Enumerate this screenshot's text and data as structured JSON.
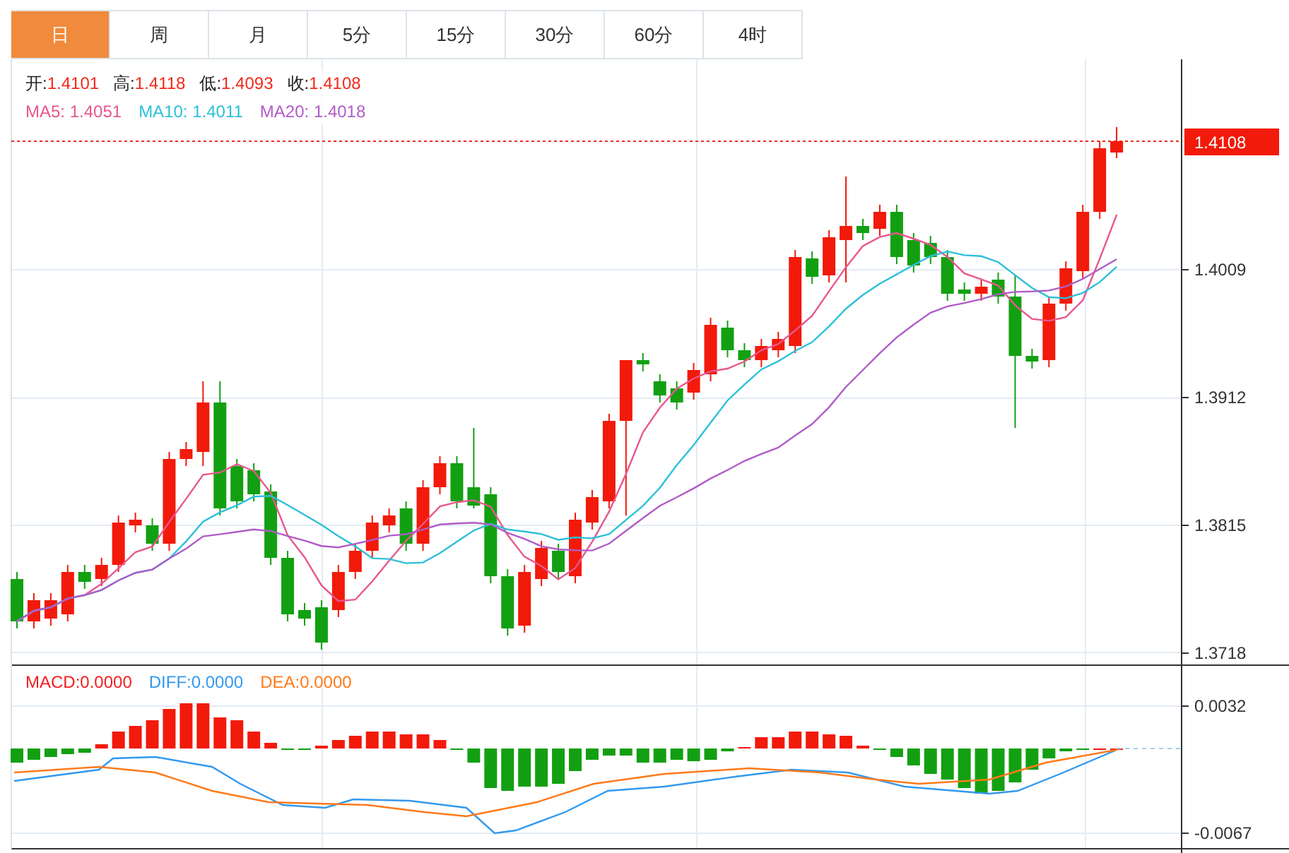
{
  "tabs": [
    {
      "label": "日",
      "selected": true
    },
    {
      "label": "周",
      "selected": false
    },
    {
      "label": "月",
      "selected": false
    },
    {
      "label": "5分",
      "selected": false
    },
    {
      "label": "15分",
      "selected": false
    },
    {
      "label": "30分",
      "selected": false
    },
    {
      "label": "60分",
      "selected": false
    },
    {
      "label": "4时",
      "selected": false
    }
  ],
  "quote": [
    {
      "label": "开:",
      "value": "1.4101"
    },
    {
      "label": "高:",
      "value": "1.4118"
    },
    {
      "label": "低:",
      "value": "1.4093"
    },
    {
      "label": "收:",
      "value": "1.4108"
    }
  ],
  "moving_averages": [
    {
      "label": "MA5:",
      "value": "1.4051",
      "color": "#e8578f"
    },
    {
      "label": "MA10:",
      "value": "1.4011",
      "color": "#2cc0d8"
    },
    {
      "label": "MA20:",
      "value": "1.4018",
      "color": "#b05cc8"
    }
  ],
  "price_axis": {
    "labels": [
      "1.4009",
      "1.3912",
      "1.3815",
      "1.3718"
    ],
    "current_price": "1.4108"
  },
  "macd": {
    "legend": [
      {
        "label": "MACD:",
        "value": "0.0000",
        "color": "#f02020"
      },
      {
        "label": "DIFF:",
        "value": "0.0000",
        "color": "#3399ee"
      },
      {
        "label": "DEA:",
        "value": "0.0000",
        "color": "#ff7a1a"
      }
    ],
    "axis_labels": [
      "0.0032",
      "-0.0067"
    ]
  }
}
